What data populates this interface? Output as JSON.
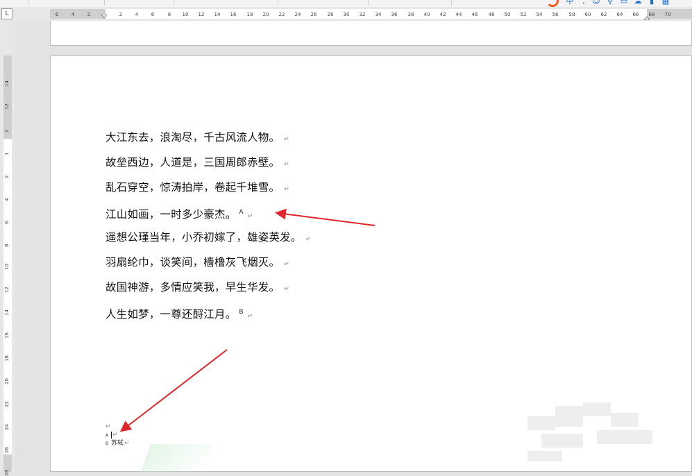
{
  "ruler": {
    "corner_symbol": "L",
    "numbers": [
      "6",
      "4",
      "2",
      "2",
      "4",
      "6",
      "8",
      "10",
      "12",
      "14",
      "16",
      "18",
      "20",
      "22",
      "24",
      "26",
      "28",
      "30",
      "32",
      "34",
      "36",
      "38",
      "40",
      "42",
      "44",
      "46",
      "48",
      "50",
      "52",
      "54",
      "56",
      "58",
      "60",
      "62",
      "64",
      "66",
      "68",
      "70"
    ],
    "vertical_numbers": [
      "14",
      "12",
      "2",
      "1",
      "2",
      "4",
      "6",
      "8",
      "10",
      "12",
      "14",
      "16",
      "18",
      "20",
      "22",
      "24",
      "26",
      "28"
    ]
  },
  "document": {
    "poem_lines": [
      {
        "text": "大江东去，浪淘尽，千古风流人物。",
        "note": ""
      },
      {
        "text": "故垒西边，人道是，三国周郎赤壁。",
        "note": ""
      },
      {
        "text": "乱石穿空，惊涛拍岸，卷起千堆雪。",
        "note": ""
      },
      {
        "text": "江山如画，一时多少豪杰。",
        "note": "A"
      },
      {
        "text": "遥想公瑾当年，小乔初嫁了，雄姿英发。",
        "note": ""
      },
      {
        "text": "羽扇纶巾，谈笑间，樯橹灰飞烟灭。",
        "note": ""
      },
      {
        "text": "故国神游，多情应笑我，早生华发。",
        "note": ""
      },
      {
        "text": "人生如梦，一尊还酹江月。",
        "note": "B"
      }
    ],
    "paragraph_mark": "↵",
    "footnotes": [
      {
        "mark": "A",
        "text": ""
      },
      {
        "mark": "B",
        "text": "苏轼"
      }
    ]
  },
  "annotations": {
    "arrow_color": "#e0262b"
  }
}
